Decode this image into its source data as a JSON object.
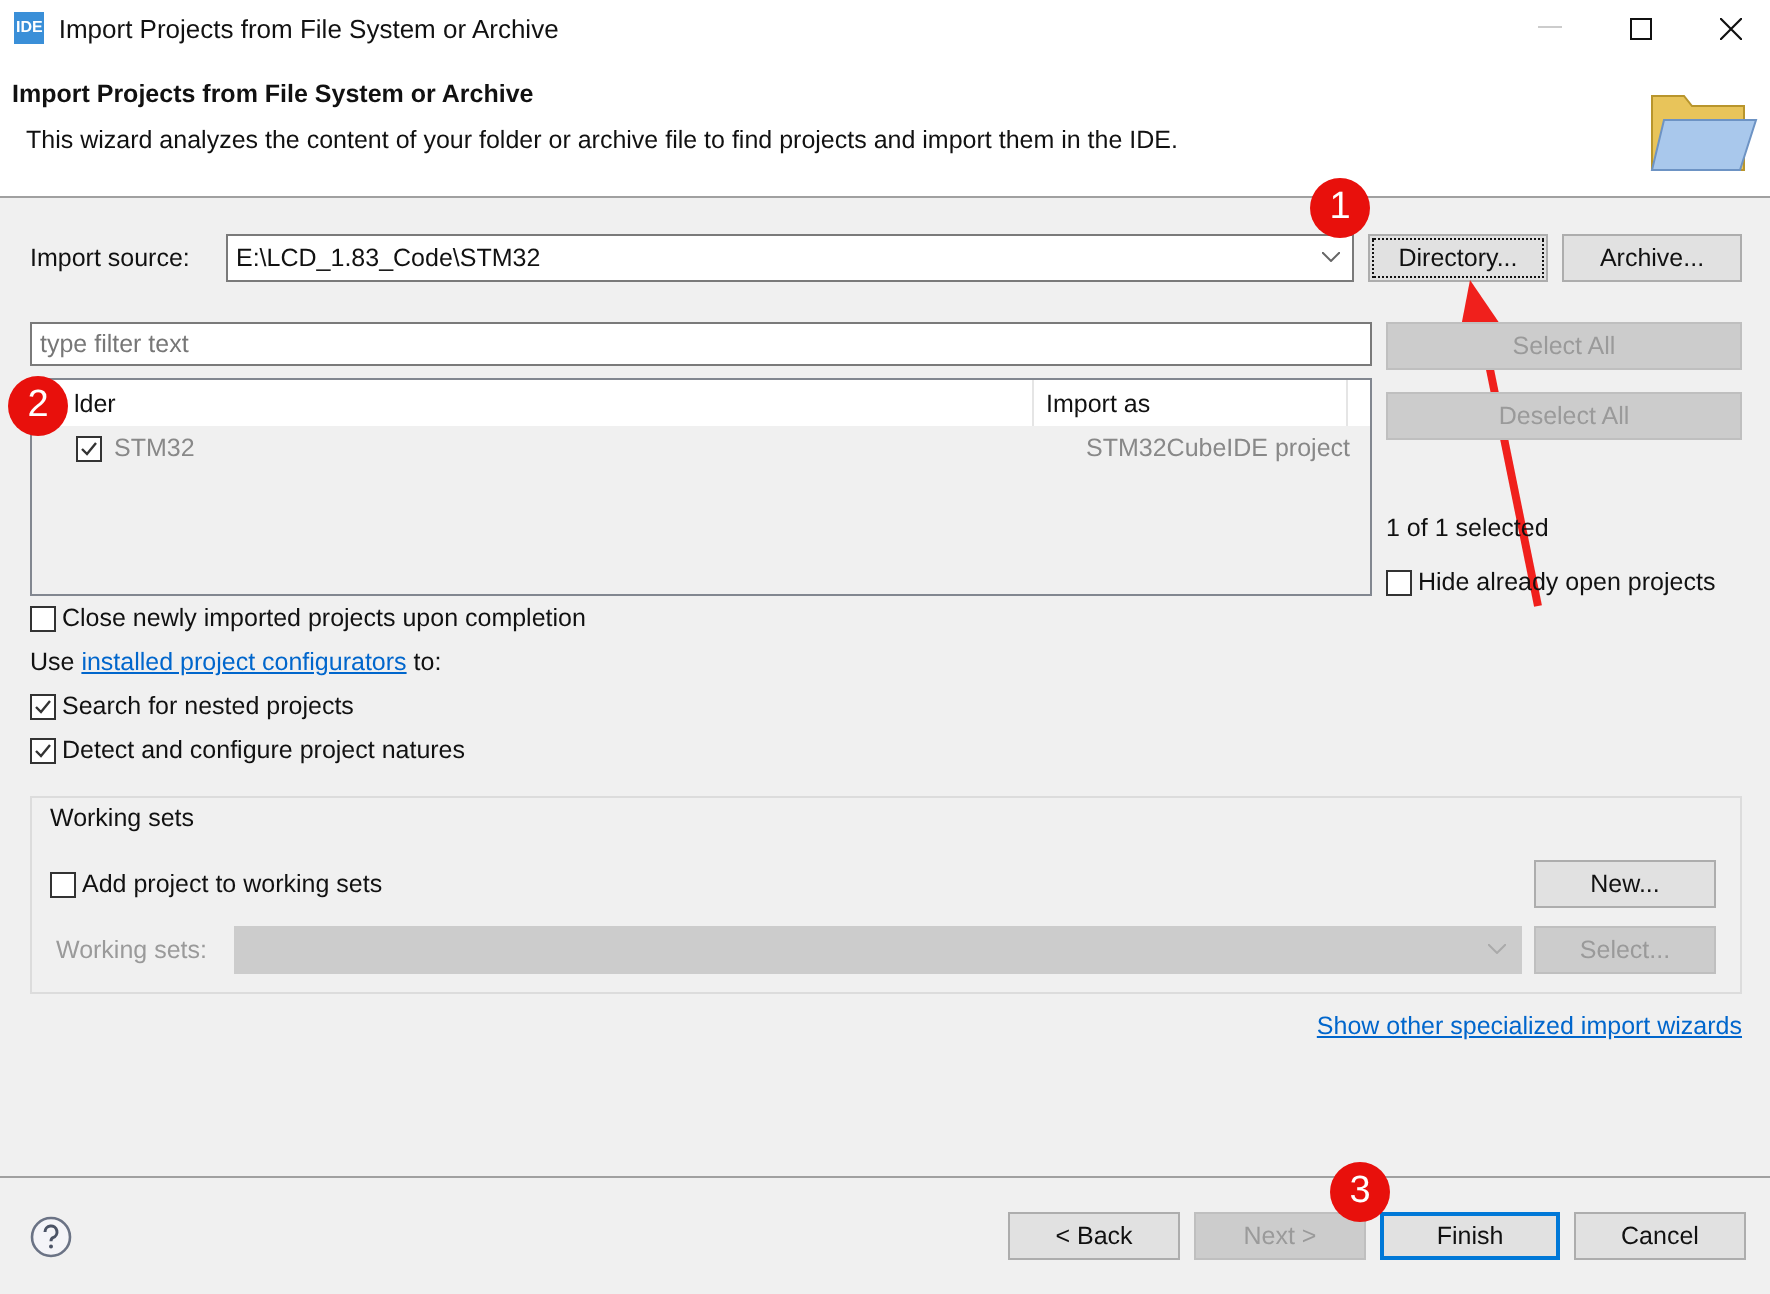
{
  "window": {
    "app_icon": "IDE",
    "title": "Import Projects from File System or Archive"
  },
  "header": {
    "title": "Import Projects from File System or Archive",
    "description": "This wizard analyzes the content of your folder or archive file to find projects and import them in the IDE."
  },
  "import_source": {
    "label": "Import source:",
    "value": "E:\\LCD_1.83_Code\\STM32",
    "buttons": [
      {
        "label": "Directory...",
        "focused": true
      },
      {
        "label": "Archive...",
        "focused": false
      }
    ]
  },
  "filter": {
    "placeholder": "type filter text"
  },
  "table": {
    "columns": [
      "lder",
      "Import as"
    ],
    "rows": [
      {
        "name": "STM32",
        "import_as": "STM32CubeIDE project",
        "checked": true
      }
    ]
  },
  "side_buttons": [
    {
      "label": "Select All",
      "disabled": true
    },
    {
      "label": "Deselect All",
      "disabled": true
    }
  ],
  "selection_count": "1 of 1 selected",
  "hide_open": {
    "label": "Hide already open projects",
    "checked": false
  },
  "close_newly": {
    "label": "Close newly imported projects upon completion",
    "checked": false
  },
  "configurators": {
    "prefix": "Use ",
    "link": "installed project configurators",
    "suffix": " to:"
  },
  "options": [
    {
      "label": "Search for nested projects",
      "checked": true
    },
    {
      "label": "Detect and configure project natures",
      "checked": true
    }
  ],
  "working_sets": {
    "title": "Working sets",
    "add": {
      "label": "Add project to working sets",
      "checked": false
    },
    "new_button": "New...",
    "field_label": "Working sets:",
    "disabled": true,
    "select_button": "Select..."
  },
  "link": "Show other specialized import wizards",
  "footer_buttons": [
    {
      "label": "< Back",
      "disabled": false,
      "default": false
    },
    {
      "label": "Next >",
      "disabled": true,
      "default": false
    },
    {
      "label": "Finish",
      "disabled": false,
      "default": true
    },
    {
      "label": "Cancel",
      "disabled": false,
      "default": false
    }
  ],
  "annotations": [
    "1",
    "2",
    "3"
  ]
}
